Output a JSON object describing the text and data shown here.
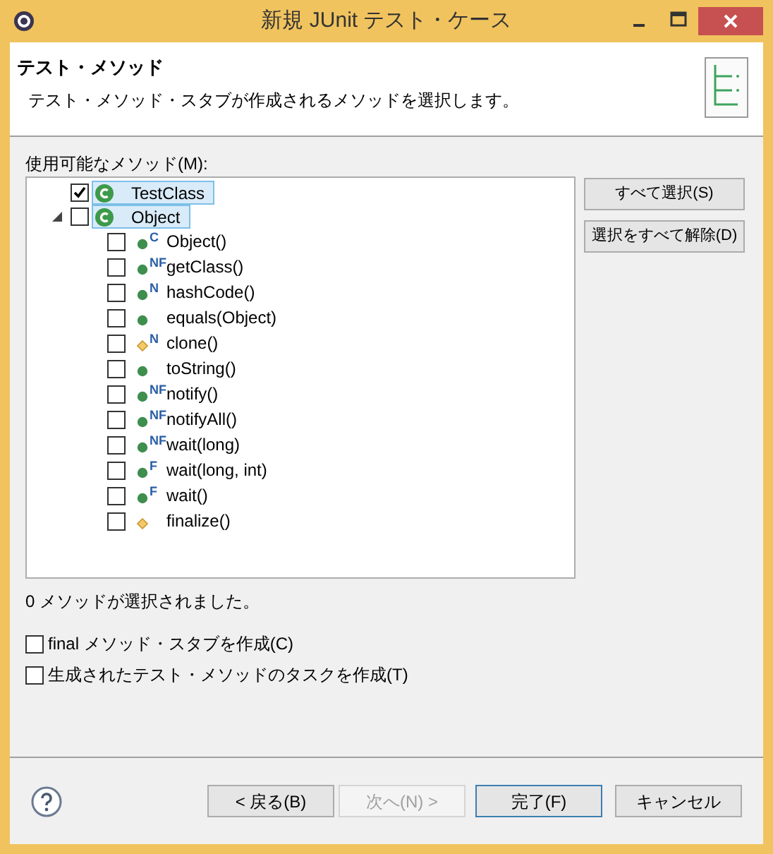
{
  "window": {
    "title": "新規 JUnit テスト・ケース"
  },
  "header": {
    "title": "テスト・メソッド",
    "description": "テスト・メソッド・スタブが作成されるメソッドを選択します。"
  },
  "methods_label": "使用可能なメソッド(M):",
  "tree": [
    {
      "label": "TestClass",
      "checked": true,
      "selected": true
    },
    {
      "label": "Object",
      "checked": false,
      "selected": true,
      "expanded": true,
      "children": [
        {
          "label": "Object()",
          "kind": "public",
          "modifiers": "C",
          "checked": false
        },
        {
          "label": "getClass()",
          "kind": "public",
          "modifiers": "NF",
          "checked": false
        },
        {
          "label": "hashCode()",
          "kind": "public",
          "modifiers": "N",
          "checked": false
        },
        {
          "label": "equals(Object)",
          "kind": "public",
          "checked": false
        },
        {
          "label": "clone()",
          "kind": "protected",
          "modifiers": "N",
          "checked": false
        },
        {
          "label": "toString()",
          "kind": "public",
          "checked": false
        },
        {
          "label": "notify()",
          "kind": "public",
          "modifiers": "NF",
          "checked": false
        },
        {
          "label": "notifyAll()",
          "kind": "public",
          "modifiers": "NF",
          "checked": false
        },
        {
          "label": "wait(long)",
          "kind": "public",
          "modifiers": "NF",
          "checked": false
        },
        {
          "label": "wait(long, int)",
          "kind": "public",
          "modifiers": "F",
          "checked": false
        },
        {
          "label": "wait()",
          "kind": "public",
          "modifiers": "F",
          "checked": false
        },
        {
          "label": "finalize()",
          "kind": "protected",
          "checked": false
        }
      ]
    }
  ],
  "side_buttons": [
    "すべて選択(S)",
    "選択をすべて解除(D)"
  ],
  "status": "0 メソッドが選択されました。",
  "options": [
    {
      "label": "final メソッド・スタブを作成(C)",
      "checked": false
    },
    {
      "label": "生成されたテスト・メソッドのタスクを作成(T)",
      "checked": false
    }
  ],
  "buttons": [
    {
      "label": "< 戻る(B)",
      "disabled": false,
      "default": false
    },
    {
      "label": "次へ(N) >",
      "disabled": true,
      "default": false
    },
    {
      "label": "完了(F)",
      "disabled": false,
      "default": true
    },
    {
      "label": "キャンセル",
      "disabled": false,
      "default": false
    }
  ]
}
